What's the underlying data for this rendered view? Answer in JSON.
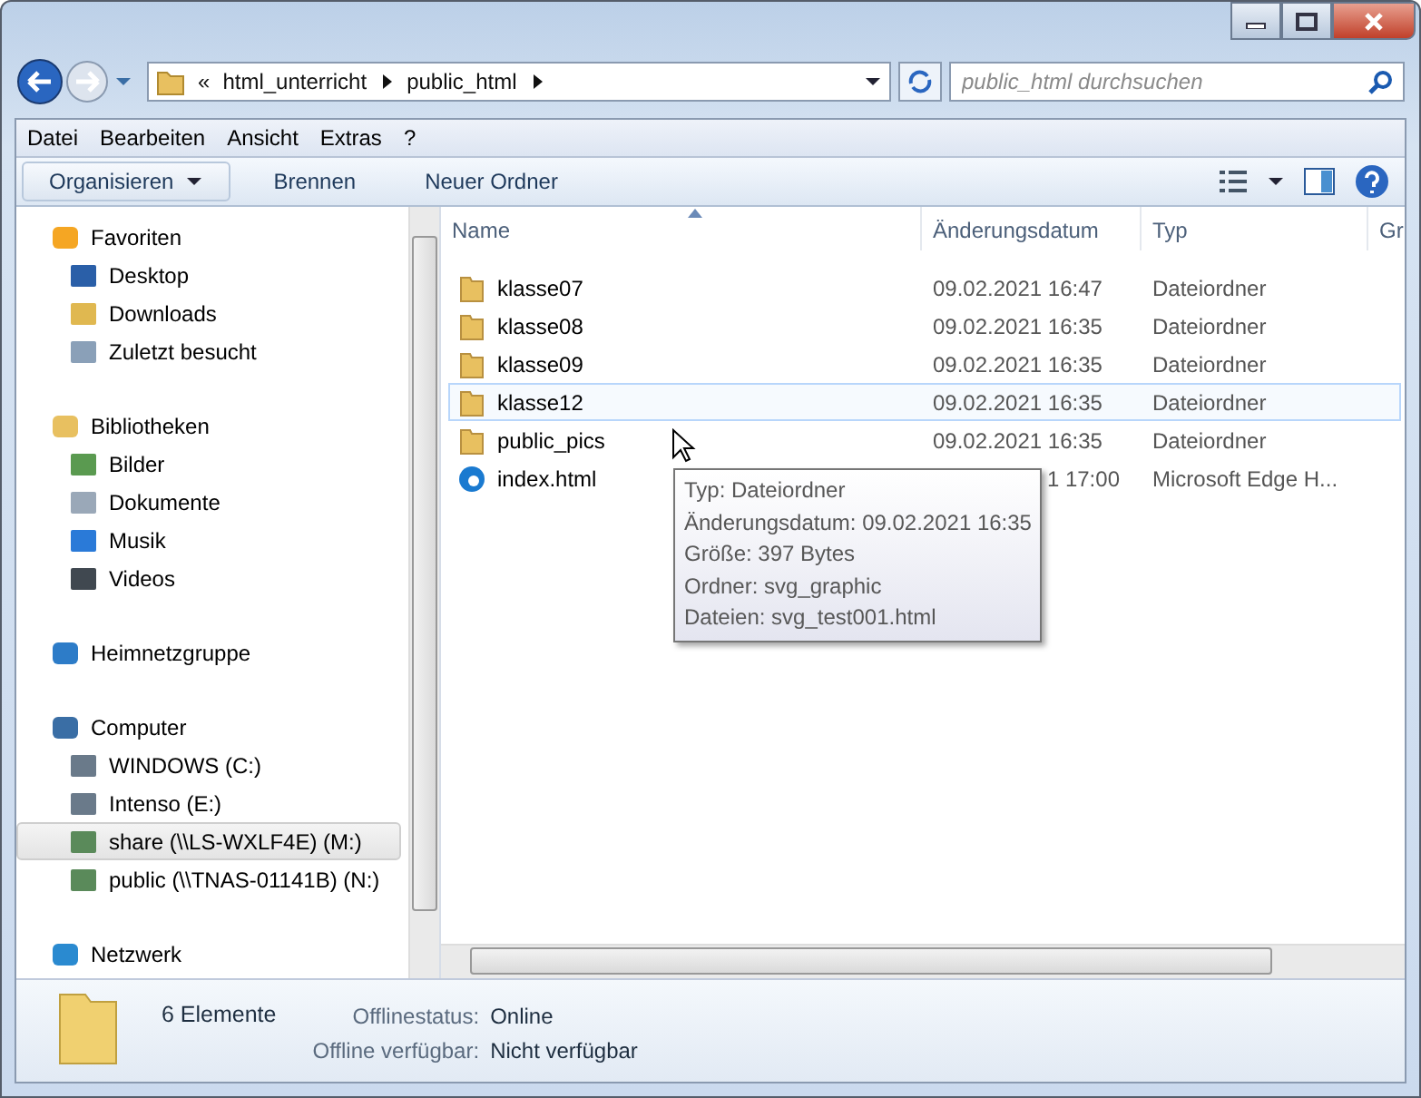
{
  "address": {
    "overflow": "«",
    "breadcrumb": [
      "html_unterricht",
      "public_html"
    ]
  },
  "search": {
    "placeholder": "public_html durchsuchen"
  },
  "menu": [
    "Datei",
    "Bearbeiten",
    "Ansicht",
    "Extras",
    "?"
  ],
  "toolbar": [
    {
      "label": "Organisieren",
      "dropdown": true
    },
    {
      "label": "Brennen",
      "dropdown": false
    },
    {
      "label": "Neuer Ordner",
      "dropdown": false
    }
  ],
  "nav": [
    {
      "label": "Favoriten",
      "selected": false,
      "children": [
        {
          "label": "Desktop",
          "selected": false
        },
        {
          "label": "Downloads",
          "selected": false
        },
        {
          "label": "Zuletzt besucht",
          "selected": false
        }
      ]
    },
    {
      "label": "Bibliotheken",
      "selected": false,
      "children": [
        {
          "label": "Bilder",
          "selected": false
        },
        {
          "label": "Dokumente",
          "selected": false
        },
        {
          "label": "Musik",
          "selected": false
        },
        {
          "label": "Videos",
          "selected": false
        }
      ]
    },
    {
      "label": "Heimnetzgruppe",
      "selected": false
    },
    {
      "label": "Computer",
      "selected": false,
      "children": [
        {
          "label": "WINDOWS (C:)",
          "selected": false
        },
        {
          "label": "Intenso (E:)",
          "selected": false
        },
        {
          "label": "share (\\\\LS-WXLF4E) (M:)",
          "selected": true
        },
        {
          "label": "public (\\\\TNAS-01141B) (N:)",
          "selected": false
        }
      ]
    },
    {
      "label": "Netzwerk",
      "selected": false
    }
  ],
  "columns": [
    "Name",
    "Änderungsdatum",
    "Typ",
    "Gr"
  ],
  "rows": [
    {
      "name": "klasse07",
      "date": "09.02.2021 16:47",
      "type": "Dateiordner",
      "kind": "folder",
      "hovered": false
    },
    {
      "name": "klasse08",
      "date": "09.02.2021 16:35",
      "type": "Dateiordner",
      "kind": "folder",
      "hovered": false
    },
    {
      "name": "klasse09",
      "date": "09.02.2021 16:35",
      "type": "Dateiordner",
      "kind": "folder",
      "hovered": false
    },
    {
      "name": "klasse12",
      "date": "09.02.2021 16:35",
      "type": "Dateiordner",
      "kind": "folder",
      "hovered": true
    },
    {
      "name": "public_pics",
      "date": "09.02.2021 16:35",
      "type": "Dateiordner",
      "kind": "folder",
      "hovered": false
    },
    {
      "name": "index.html",
      "date": "1 17:00",
      "type": "Microsoft Edge H...",
      "kind": "html",
      "hovered": false
    }
  ],
  "tooltip": [
    "Typ: Dateiordner",
    "Änderungsdatum: 09.02.2021 16:35",
    "Größe: 397 Bytes",
    "Ordner: svg_graphic",
    "Dateien: svg_test001.html"
  ],
  "details": {
    "count": "6 Elemente",
    "fields": [
      {
        "label": "Offlinestatus:",
        "value": "Online"
      },
      {
        "label": "Offline verfügbar:",
        "value": "Nicht verfügbar"
      }
    ]
  }
}
